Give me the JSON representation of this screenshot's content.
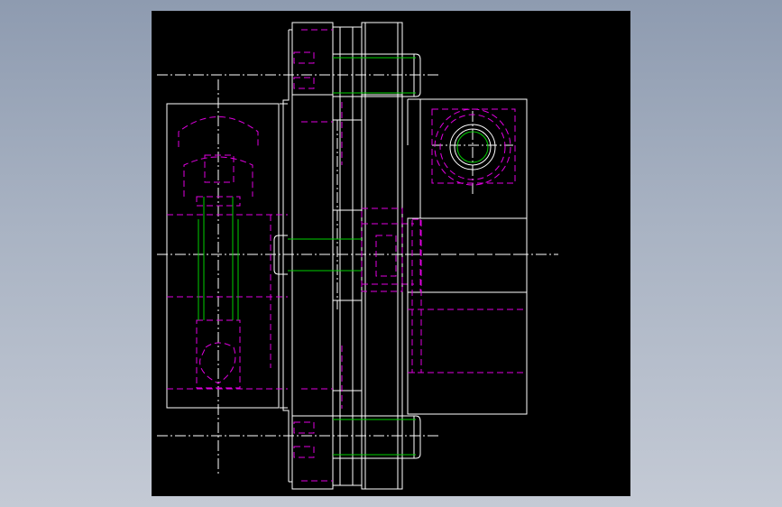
{
  "canvas": {
    "background": "#000000",
    "outer_background_top": "#8e9bb0",
    "outer_background_bottom": "#c4cad5"
  },
  "drawing": {
    "line_colors": {
      "visible": "#ffffff",
      "hidden": "#e000e0",
      "thread": "#00d000"
    },
    "views": [
      "front-section-view",
      "side-view"
    ]
  }
}
